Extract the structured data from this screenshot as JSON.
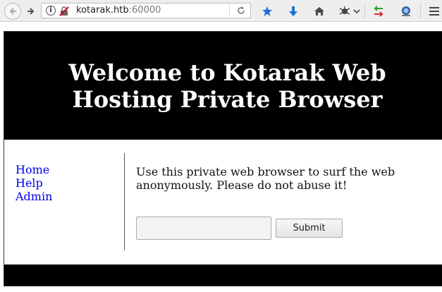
{
  "browser": {
    "url_host": "kotarak.htb",
    "url_port": ":60000",
    "icons": {
      "back": "back-arrow-icon",
      "forward": "forward-arrow-icon",
      "info": "info-icon",
      "insecure": "insecure-connection-icon",
      "reload": "reload-icon",
      "bookmark": "bookmark-icon",
      "downloads": "download-icon",
      "home": "home-icon",
      "extension": "extension-icon",
      "sync": "sync-arrows-icon",
      "addon": "globe-addon-icon",
      "menu": "hamburger-menu-icon"
    },
    "info_glyph": "i"
  },
  "page": {
    "title": "Welcome to Kotarak Web Hosting Private Browser",
    "nav": [
      {
        "label": "Home"
      },
      {
        "label": "Help"
      },
      {
        "label": "Admin"
      }
    ],
    "intro": "Use this private web browser to surf the web anonymously. Please do not abuse it!",
    "form": {
      "input_value": "",
      "submit_label": "Submit"
    }
  },
  "colors": {
    "header_bg": "#000000",
    "header_text": "#ffffff",
    "link": "#0000ee"
  }
}
